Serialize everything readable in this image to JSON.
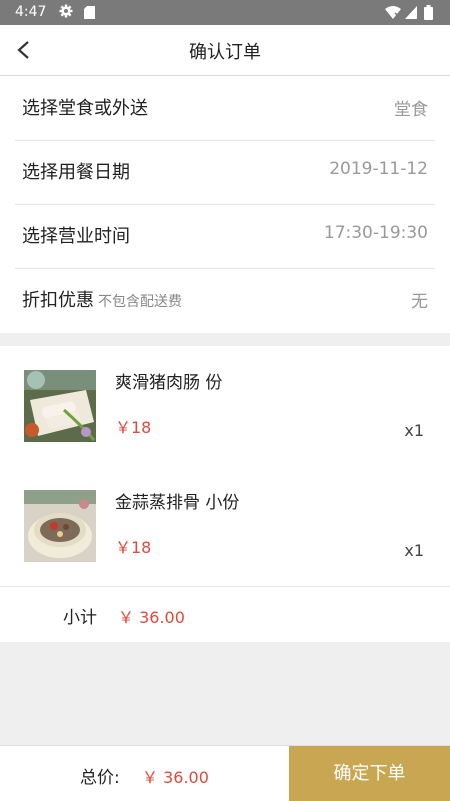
{
  "status_bar": {
    "time": "4:47"
  },
  "header": {
    "title": "确认订单"
  },
  "options": [
    {
      "label": "选择堂食或外送",
      "note": "",
      "value": "堂食"
    },
    {
      "label": "选择用餐日期",
      "note": "",
      "value": "2019-11-12"
    },
    {
      "label": "选择营业时间",
      "note": "",
      "value": "17:30-19:30"
    },
    {
      "label": "折扣优惠",
      "note": "不包含配送费",
      "value": "无"
    }
  ],
  "items": [
    {
      "name": "爽滑猪肉肠 份",
      "price": "￥18",
      "qty": "x1"
    },
    {
      "name": "金蒜蒸排骨 小份",
      "price": "￥18",
      "qty": "x1"
    }
  ],
  "subtotal": {
    "label": "小计",
    "value": "￥ 36.00"
  },
  "footer": {
    "total_label": "总价:",
    "total_value": "￥ 36.00",
    "confirm_label": "确定下单"
  },
  "colors": {
    "accent": "#c9a651",
    "price": "#e04a3c",
    "status_bar": "#7a7a7a"
  }
}
